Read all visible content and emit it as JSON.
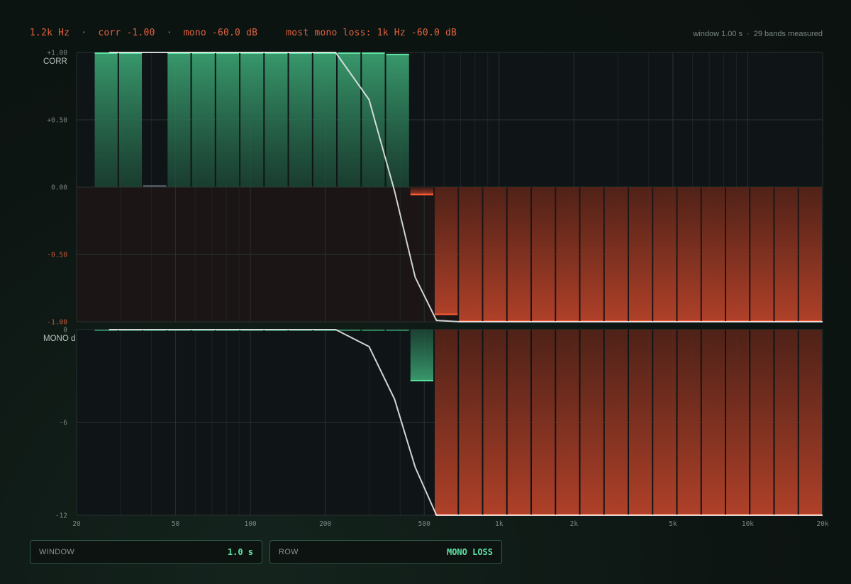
{
  "header": {
    "freq": "1.2k Hz",
    "sep": "·",
    "corr": "corr -1.00",
    "mono": "mono -60.0 dB",
    "loss": "most mono loss: 1k Hz -60.0 dB",
    "window": "window 1.00 s",
    "bands": "29 bands measured"
  },
  "controls": {
    "window_label": "WINDOW",
    "window_value": "1.0 s",
    "row_label": "ROW",
    "row_value": "MONO LOSS"
  },
  "colors": {
    "positive": "#3cb37c",
    "negative": "#c5472a",
    "curve": "#e8e8e8",
    "accent_text": "#e0623f"
  },
  "chart_data": {
    "type": "bar",
    "x_scale": "log",
    "x_range": [
      20,
      20000
    ],
    "x_ticks": [
      "20",
      "50",
      "100",
      "200",
      "500",
      "1k",
      "2k",
      "5k",
      "10k",
      "20k"
    ],
    "x_tick_values": [
      20,
      50,
      100,
      200,
      500,
      1000,
      2000,
      5000,
      10000,
      20000
    ],
    "band_count": 30,
    "panels": [
      {
        "id": "corr",
        "label": "CORR",
        "ylim": [
          -1,
          1
        ],
        "y_ticks": [
          "+1.00",
          "+0.50",
          "0.00",
          "-0.50",
          "-1.00"
        ],
        "y_tick_values": [
          1,
          0.5,
          0,
          -0.5,
          -1
        ],
        "values": [
          1,
          1,
          0.01,
          1,
          1,
          1,
          1,
          1,
          1,
          1,
          1,
          1,
          0.99,
          -0.06,
          -0.95,
          -1,
          -1,
          -1,
          -1,
          -1,
          -1,
          -1,
          -1,
          -1,
          -1,
          -1,
          -1,
          -1,
          -1,
          -1
        ],
        "curve": [
          1,
          1,
          1,
          1,
          1,
          1,
          1,
          1,
          1,
          1,
          1,
          0.65,
          -0.03,
          -0.67,
          -0.99,
          -1,
          -1,
          -1,
          -1,
          -1,
          -1,
          -1,
          -1,
          -1,
          -1,
          -1,
          -1,
          -1,
          -1,
          -1
        ],
        "curve_x": [
          27,
          32,
          38,
          45,
          55,
          65,
          78,
          93,
          111,
          132,
          220,
          300,
          380,
          460,
          560,
          700,
          900,
          1200,
          1600,
          2100,
          2800,
          3700,
          4900,
          6400,
          8400,
          11000,
          14000,
          17000,
          19000,
          20000
        ]
      },
      {
        "id": "mono",
        "label": "MONO d",
        "ylim": [
          -12,
          0
        ],
        "y_ticks": [
          "0",
          "-6",
          "-12"
        ],
        "y_tick_values": [
          0,
          -6,
          -12
        ],
        "values": [
          0,
          0,
          0,
          0,
          0,
          0,
          0,
          0,
          0,
          0,
          0,
          0,
          -0.05,
          -3.3,
          -12,
          -12,
          -12,
          -12,
          -12,
          -12,
          -12,
          -12,
          -12,
          -12,
          -12,
          -12,
          -12,
          -12,
          -12,
          -12
        ],
        "curve": [
          0,
          0,
          0,
          0,
          0,
          0,
          0,
          0,
          0,
          0,
          0,
          -1.1,
          -4.5,
          -8.9,
          -12,
          -12,
          -12,
          -12,
          -12,
          -12,
          -12,
          -12,
          -12,
          -12,
          -12,
          -12,
          -12,
          -12,
          -12,
          -12
        ],
        "curve_x": [
          27,
          32,
          38,
          45,
          55,
          65,
          78,
          93,
          111,
          132,
          220,
          300,
          380,
          460,
          560,
          700,
          900,
          1200,
          1600,
          2100,
          2800,
          3700,
          4900,
          6400,
          8400,
          11000,
          14000,
          17000,
          19000,
          20000
        ]
      }
    ]
  }
}
